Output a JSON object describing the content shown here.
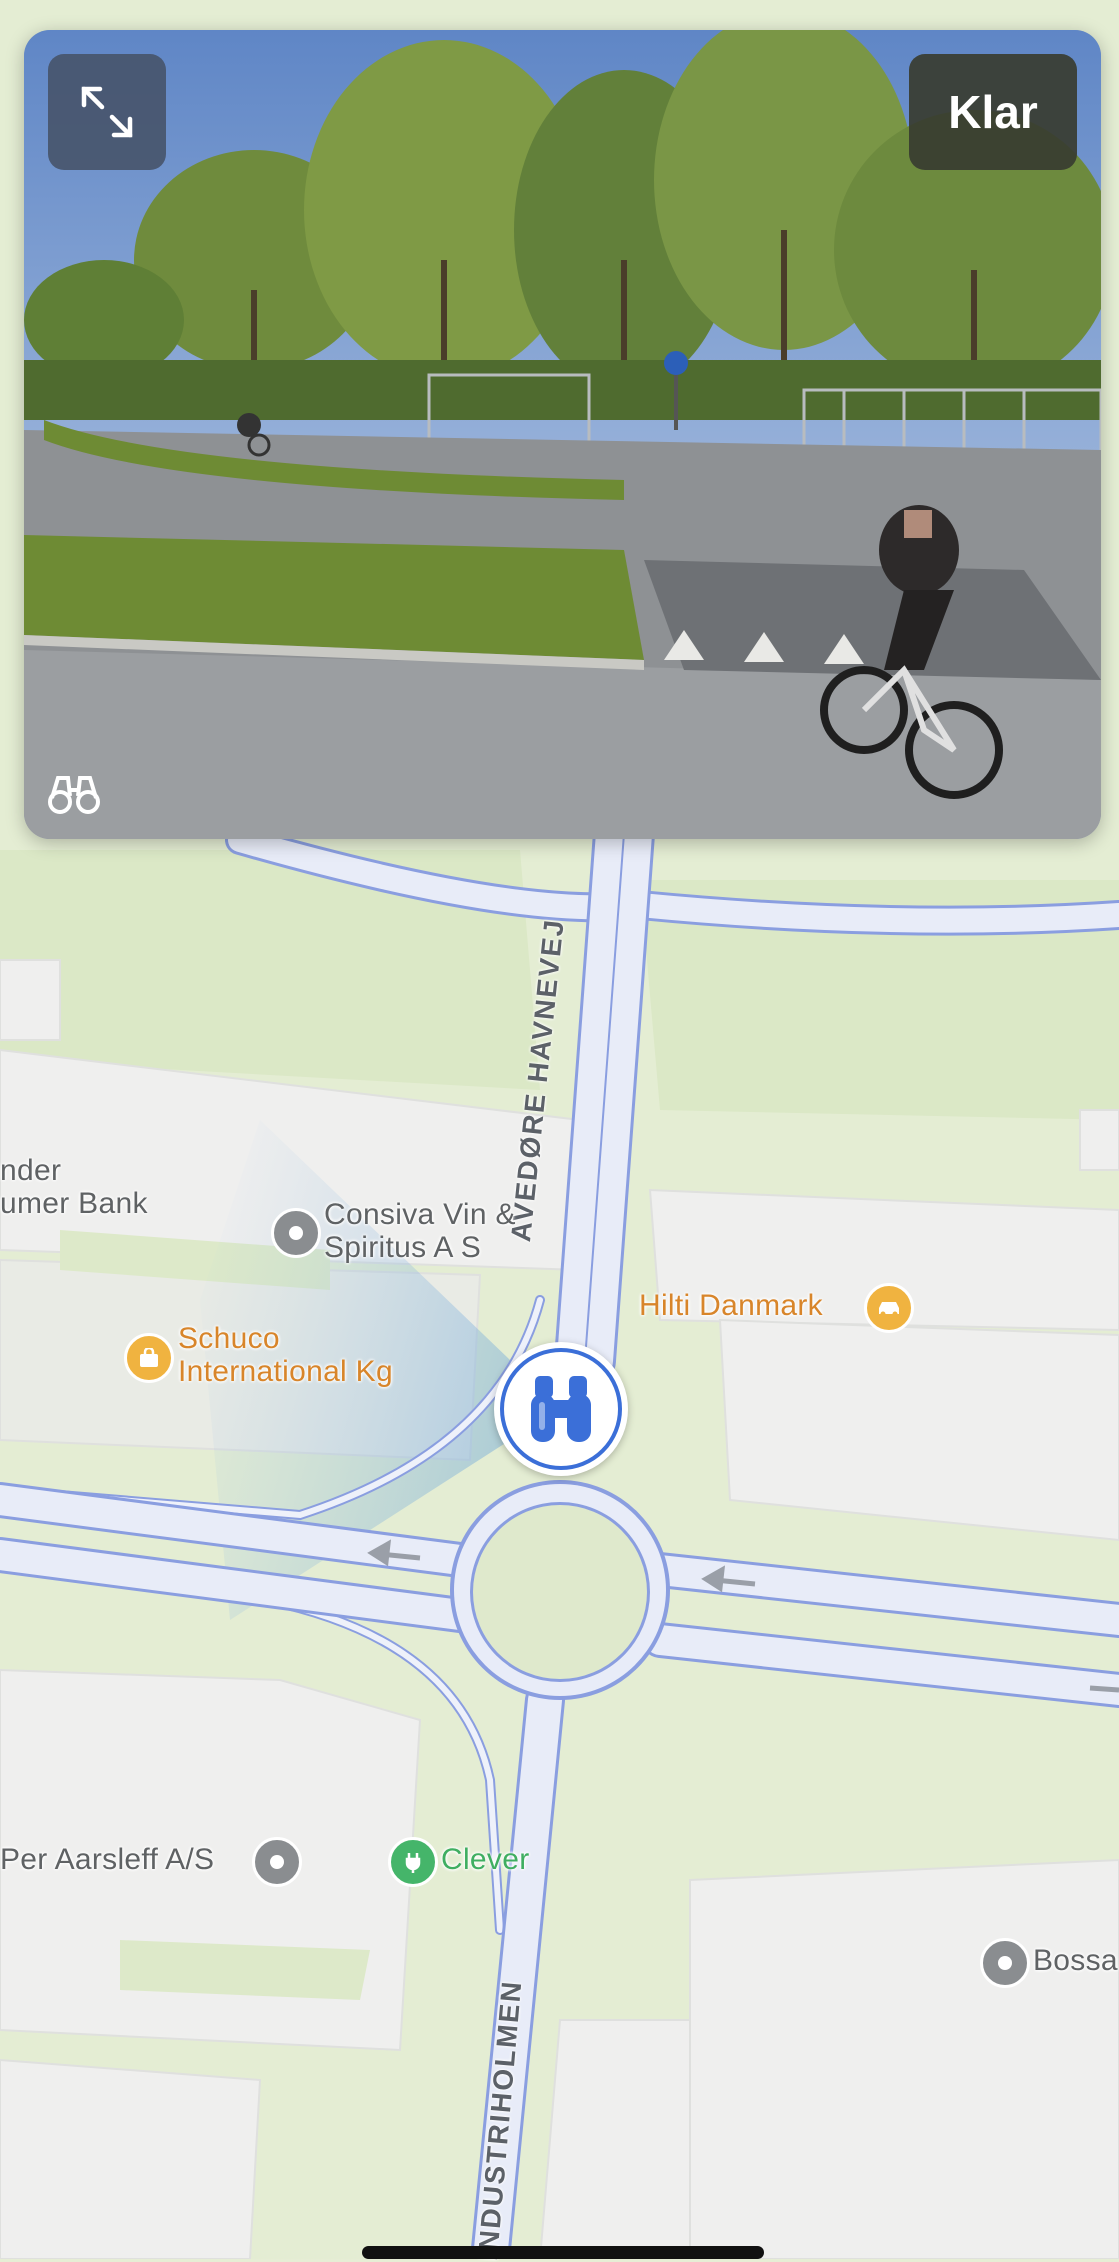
{
  "look_around": {
    "done_label": "Klar",
    "expand_icon": "expand-arrows-icon",
    "mode_icon": "binoculars-icon"
  },
  "map": {
    "roads": [
      {
        "name": "AVEDØRE HAVNEVEJ"
      },
      {
        "name": "INDUSTRIHOLMEN"
      }
    ],
    "pois": [
      {
        "name": "Consiva Vin & Spiritus A S",
        "line1": "Consiva Vin &",
        "line2": "Spiritus A S",
        "icon": "gray-dot-icon"
      },
      {
        "name": "Schuco International Kg",
        "line1": "Schuco",
        "line2": "International Kg",
        "icon": "shopping-bag-icon"
      },
      {
        "name": "Hilti Danmark",
        "icon": "car-icon"
      },
      {
        "name": "Per Aarsleff A/S",
        "icon": "gray-dot-icon"
      },
      {
        "name": "Clever",
        "icon": "charging-station-icon"
      },
      {
        "name": "Bossa",
        "icon": "gray-dot-icon"
      },
      {
        "name": "nder umer Bank",
        "line1": "nder",
        "line2": "umer Bank"
      }
    ],
    "marker_icon": "binoculars-marker-icon"
  }
}
